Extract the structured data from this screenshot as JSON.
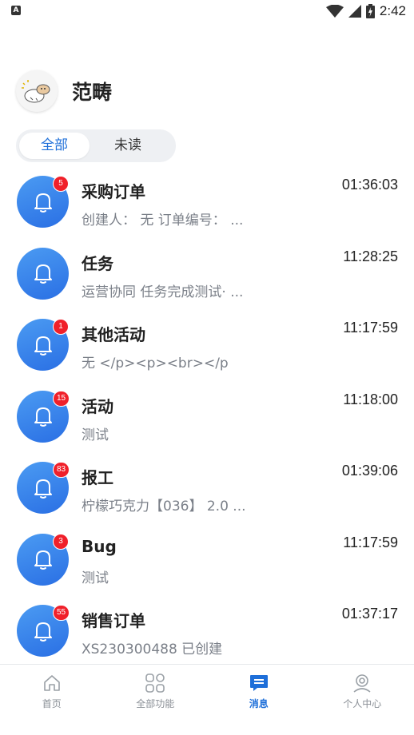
{
  "status_bar": {
    "time": "2:42",
    "left_icon": "A"
  },
  "header": {
    "user_name": "范畴",
    "avatar_icon": "cartoon-avatar-icon"
  },
  "tabs": [
    {
      "label": "全部",
      "active": true
    },
    {
      "label": "未读",
      "active": false
    }
  ],
  "messages": [
    {
      "title": "采购订单",
      "subtitle": "创建人： 无 订单编号： ...",
      "time": "01:36:03",
      "badge": "5"
    },
    {
      "title": "任务",
      "subtitle": "运营协同 任务完成测试· ...",
      "time": "11:28:25",
      "badge": ""
    },
    {
      "title": "其他活动",
      "subtitle": "无 </p><p><br></p",
      "time": "11:17:59",
      "badge": "1"
    },
    {
      "title": "活动",
      "subtitle": "测试",
      "time": "11:18:00",
      "badge": "15"
    },
    {
      "title": "报工",
      "subtitle": "柠檬巧克力【036】 2.0 ...",
      "time": "01:39:06",
      "badge": "83"
    },
    {
      "title": "Bug",
      "subtitle": "测试",
      "time": "11:17:59",
      "badge": "3"
    },
    {
      "title": "销售订单",
      "subtitle": "XS230300488 已创建",
      "time": "01:37:17",
      "badge": "55"
    }
  ],
  "bottom_nav": [
    {
      "label": "首页",
      "icon": "home-icon",
      "active": false
    },
    {
      "label": "全部功能",
      "icon": "grid-icon",
      "active": false
    },
    {
      "label": "消息",
      "icon": "message-icon",
      "active": true
    },
    {
      "label": "个人中心",
      "icon": "profile-icon",
      "active": false
    }
  ],
  "colors": {
    "accent": "#1e6fd9",
    "badge": "#f0202a",
    "icon_gradient_start": "#4b9bf2",
    "icon_gradient_end": "#2a6fe4",
    "subtitle": "#7b8089"
  }
}
